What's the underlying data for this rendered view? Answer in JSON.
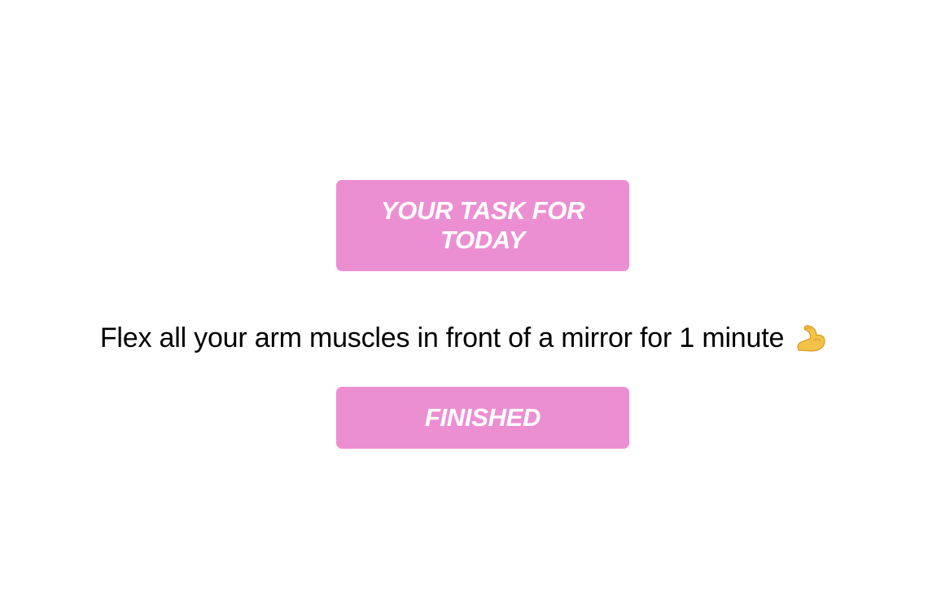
{
  "task_card": {
    "heading": "YOUR TASK FOR TODAY",
    "description": "Flex all your arm muscles in front of a mirror for 1 minute",
    "description_icon": "flexed-biceps-icon"
  },
  "actions": {
    "finished_label": "FINISHED"
  },
  "colors": {
    "accent": "#ec8fd2",
    "button_text": "#ffffff",
    "body_text": "#000000",
    "background": "#ffffff"
  }
}
